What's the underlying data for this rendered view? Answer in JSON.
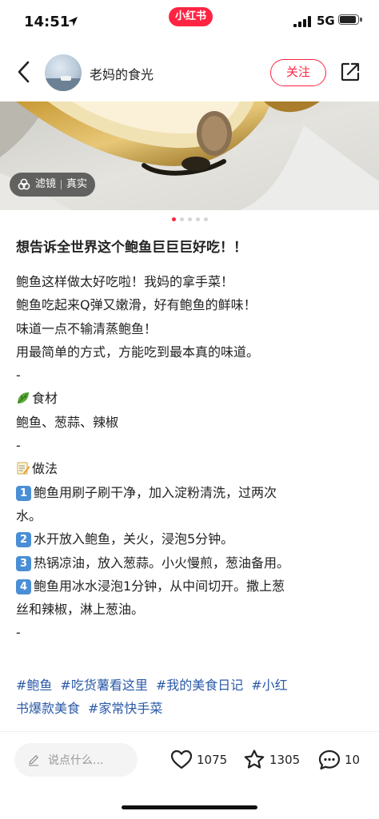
{
  "status": {
    "time": "14:51",
    "network": "5G",
    "app_badge": "小红书",
    "battery_level": 0.95
  },
  "author": {
    "name": "老妈的食光",
    "follow_label": "关注"
  },
  "image": {
    "filter_label": "滤镜",
    "filter_value": "真实",
    "page_count": 5,
    "current_page": 1
  },
  "post": {
    "title": "想告诉全世界这个鲍鱼巨巨巨好吃！！",
    "intro": [
      "鲍鱼这样做太好吃啦！我妈的拿手菜！",
      "鲍鱼吃起来Q弹又嫩滑，好有鲍鱼的鲜味！",
      "味道一点不输清蒸鲍鱼！",
      "用最简单的方式，方能吃到最本真的味道。"
    ],
    "sep1": "-",
    "ingredients_heading": "食材",
    "ingredients": "鲍鱼、葱蒜、辣椒",
    "sep2": "-",
    "method_heading": "做法",
    "steps": [
      {
        "num": "1",
        "text": "鲍鱼用刷子刷干净，加入淀粉清洗，过两次",
        "cont": "水。"
      },
      {
        "num": "2",
        "text": "水开放入鲍鱼，关火，浸泡5分钟。"
      },
      {
        "num": "3",
        "text": "热锅凉油，放入葱蒜。小火慢煎，葱油备用。"
      },
      {
        "num": "4",
        "text": "鲍鱼用冰水浸泡1分钟，从中间切开。撒上葱",
        "cont": "丝和辣椒，淋上葱油。"
      }
    ],
    "sep3": "-",
    "tags": [
      "#鲍鱼",
      "#吃货薯看这里",
      "#我的美食日记",
      "#小红",
      "书爆款美食",
      "#家常快手菜"
    ]
  },
  "bottom_bar": {
    "comment_placeholder": "说点什么...",
    "likes": "1075",
    "collects": "1305",
    "comments": "10"
  },
  "colors": {
    "brand": "#ff2442",
    "tag": "#2b5aa8",
    "keycap": "#4a8fd6"
  }
}
